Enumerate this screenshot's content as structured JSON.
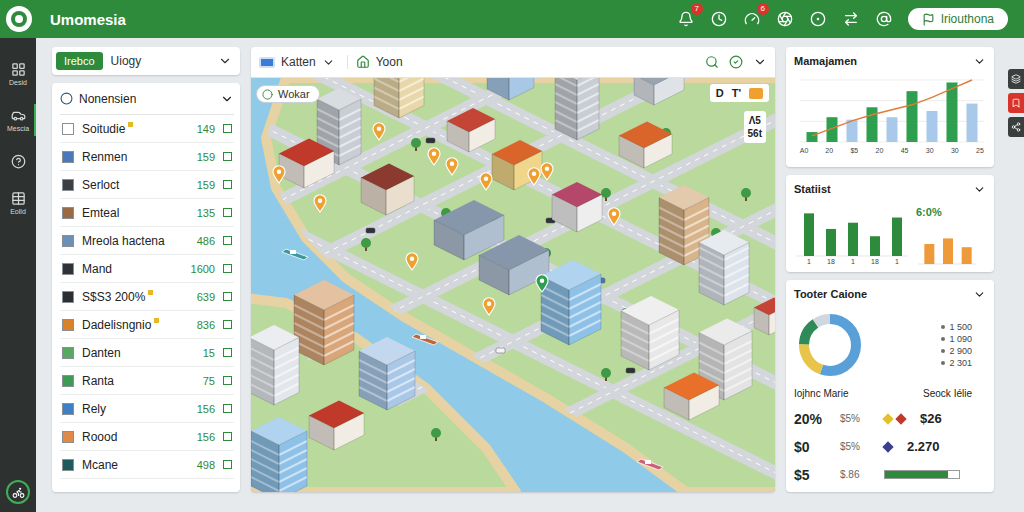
{
  "app": {
    "title": "Umomesia",
    "action_button": "Iriouthona",
    "badges": [
      "7",
      "6"
    ]
  },
  "rail": {
    "items": [
      {
        "kind": "labeled",
        "label": "Desid",
        "selected": false
      },
      {
        "kind": "labeled",
        "label": "Mescia",
        "selected": true
      },
      {
        "kind": "icon",
        "selected": false
      },
      {
        "kind": "labeled",
        "label": "Eolld",
        "selected": false
      }
    ]
  },
  "filter_bar": {
    "tag": "Irebco",
    "select": "Uiogy"
  },
  "list": {
    "title": "Nonensien",
    "rows": [
      {
        "label": "Soitudie",
        "value": "149",
        "marked": true,
        "color": "#ffffff"
      },
      {
        "label": "Renmen",
        "value": "159",
        "marked": false,
        "color": "#4a78b8"
      },
      {
        "label": "Serloct",
        "value": "159",
        "marked": false,
        "color": "#3c3f44"
      },
      {
        "label": "Emteal",
        "value": "135",
        "marked": false,
        "color": "#9a6a45"
      },
      {
        "label": "Mreola hactena",
        "value": "486",
        "marked": false,
        "color": "#6d8fb5"
      },
      {
        "label": "Mand",
        "value": "1600",
        "marked": false,
        "color": "#2f3338"
      },
      {
        "label": "S$S3 200%",
        "value": "639",
        "marked": true,
        "color": "#2b2f33"
      },
      {
        "label": "Dadelisngnio",
        "value": "836",
        "marked": true,
        "color": "#d9822b"
      },
      {
        "label": "Danten",
        "value": "15",
        "marked": false,
        "color": "#58a863"
      },
      {
        "label": "Ranta",
        "value": "75",
        "marked": false,
        "color": "#3f9a55"
      },
      {
        "label": "Rely",
        "value": "156",
        "marked": false,
        "color": "#3f7fc4"
      },
      {
        "label": "Roood",
        "value": "156",
        "marked": false,
        "color": "#e08a4a"
      },
      {
        "label": "Mcane",
        "value": "498",
        "marked": false,
        "color": "#1f5a5e"
      }
    ]
  },
  "map_toolbar": {
    "layer": "Katten",
    "place": "Yoon"
  },
  "map": {
    "chip": "Wokar",
    "corner": [
      "D",
      "T'"
    ],
    "scale": [
      "Λ5",
      "56t"
    ]
  },
  "management": {
    "title": "Mamajamen",
    "x_ticks": [
      "A0",
      "20",
      "$5",
      "20",
      "45",
      "30",
      "30",
      "25"
    ],
    "bars": [
      {
        "value": 16,
        "color": "#2e9e4f"
      },
      {
        "value": 40,
        "color": "#2e9e4f"
      },
      {
        "value": 36,
        "color": "#a9c9ea"
      },
      {
        "value": 56,
        "color": "#2e9e4f"
      },
      {
        "value": 40,
        "color": "#a9c9ea"
      },
      {
        "value": 82,
        "color": "#2e9e4f"
      },
      {
        "value": 50,
        "color": "#a9c9ea"
      },
      {
        "value": 96,
        "color": "#2e9e4f"
      },
      {
        "value": 62,
        "color": "#a9c9ea"
      }
    ],
    "line": [
      10,
      22,
      34,
      44,
      52,
      60,
      72,
      86,
      100
    ]
  },
  "statistics": {
    "title": "Statiist",
    "value": "6:0%",
    "green_bars": [
      82,
      52,
      64,
      38,
      74
    ],
    "orange_bars": [
      50,
      64,
      42
    ],
    "x_ticks": [
      "1",
      "18",
      "1",
      "18",
      "1"
    ]
  },
  "summary": {
    "title": "Tooter Caione",
    "segments": [
      {
        "value": 55,
        "color": "#5aa0d8"
      },
      {
        "value": 20,
        "color": "#e8c44a"
      },
      {
        "value": 15,
        "color": "#2e8b57"
      },
      {
        "value": 10,
        "color": "#cfd8e0"
      }
    ],
    "legend": [
      "1 500",
      "1 090",
      "2 900",
      "2 301"
    ],
    "columns": [
      "Iojhnc Marie",
      "Seock Iélie"
    ],
    "rows": [
      {
        "kind": "mark",
        "amount": "20%",
        "share": "$5%",
        "value": "$26",
        "marks": [
          "#e5c02a",
          "#c0392b"
        ]
      },
      {
        "kind": "mark",
        "amount": "$0",
        "share": "$5%",
        "value": "2.270",
        "marks": [
          "#3b3f8f"
        ]
      },
      {
        "kind": "meter",
        "amount": "$5",
        "share": "$.86",
        "level": 0.85
      }
    ]
  },
  "side_tabs": [
    {
      "selected": false
    },
    {
      "selected": true
    },
    {
      "selected": false
    }
  ]
}
